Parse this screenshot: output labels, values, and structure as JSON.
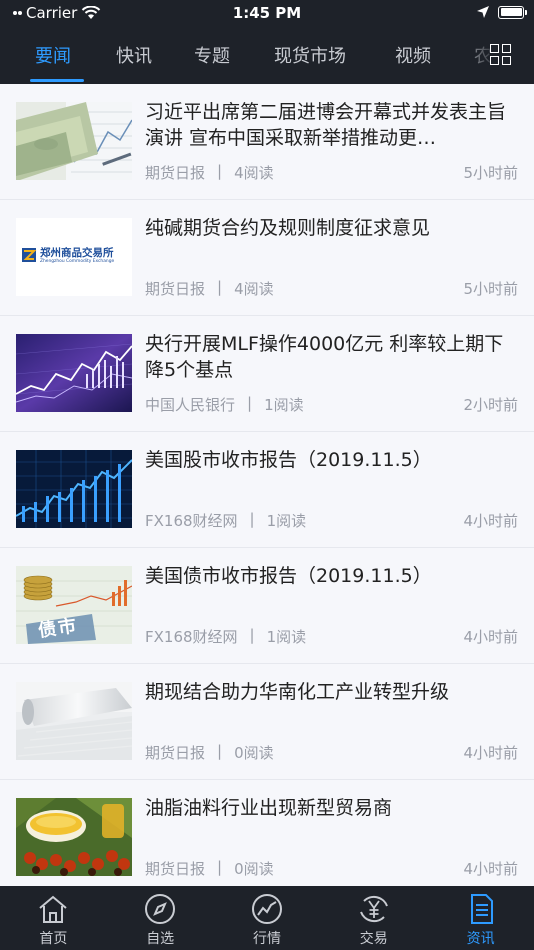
{
  "status_bar": {
    "carrier": "Carrier",
    "time": "1:45 PM"
  },
  "tabs": [
    {
      "label": "要闻",
      "active": true
    },
    {
      "label": "快讯"
    },
    {
      "label": "专题"
    },
    {
      "label": "现货市场"
    },
    {
      "label": "视频"
    },
    {
      "label": "农"
    }
  ],
  "news": [
    {
      "title": "习近平出席第二届进博会开幕式并发表主旨演讲 宣布中国采取新举措推动更…",
      "source": "期货日报",
      "reads": "4阅读",
      "age": "5小时前",
      "thumb": "money-chart-thumbnail"
    },
    {
      "title": "纯碱期货合约及规则制度征求意见",
      "source": "期货日报",
      "reads": "4阅读",
      "age": "5小时前",
      "thumb": "zce-logo-thumbnail",
      "logo_cn": "郑州商品交易所",
      "logo_en": "Zhengzhou Commodity Exchange"
    },
    {
      "title": "央行开展MLF操作4000亿元 利率较上期下降5个基点",
      "source": "中国人民银行",
      "reads": "1阅读",
      "age": "2小时前",
      "thumb": "purple-chart-thumbnail"
    },
    {
      "title": "美国股市收市报告（2019.11.5）",
      "source": "FX168财经网",
      "reads": "1阅读",
      "age": "4小时前",
      "thumb": "blue-stock-chart-thumbnail"
    },
    {
      "title": "美国债市收市报告（2019.11.5）",
      "source": "FX168财经网",
      "reads": "1阅读",
      "age": "4小时前",
      "thumb": "bond-market-thumbnail",
      "thumb_text": "债市"
    },
    {
      "title": "期现结合助力华南化工产业转型升级",
      "source": "期货日报",
      "reads": "0阅读",
      "age": "4小时前",
      "thumb": "plastic-film-thumbnail"
    },
    {
      "title": "油脂油料行业出现新型贸易商",
      "source": "期货日报",
      "reads": "0阅读",
      "age": "4小时前",
      "thumb": "oil-palm-thumbnail"
    }
  ],
  "bottom_nav": [
    {
      "label": "首页",
      "icon": "home-icon"
    },
    {
      "label": "自选",
      "icon": "compass-icon"
    },
    {
      "label": "行情",
      "icon": "chart-line-icon"
    },
    {
      "label": "交易",
      "icon": "yen-exchange-icon"
    },
    {
      "label": "资讯",
      "icon": "document-icon",
      "active": true
    }
  ],
  "colors": {
    "bar_bg": "#1e2229",
    "accent": "#2e9bff",
    "list_bg": "#f6f7fb"
  }
}
